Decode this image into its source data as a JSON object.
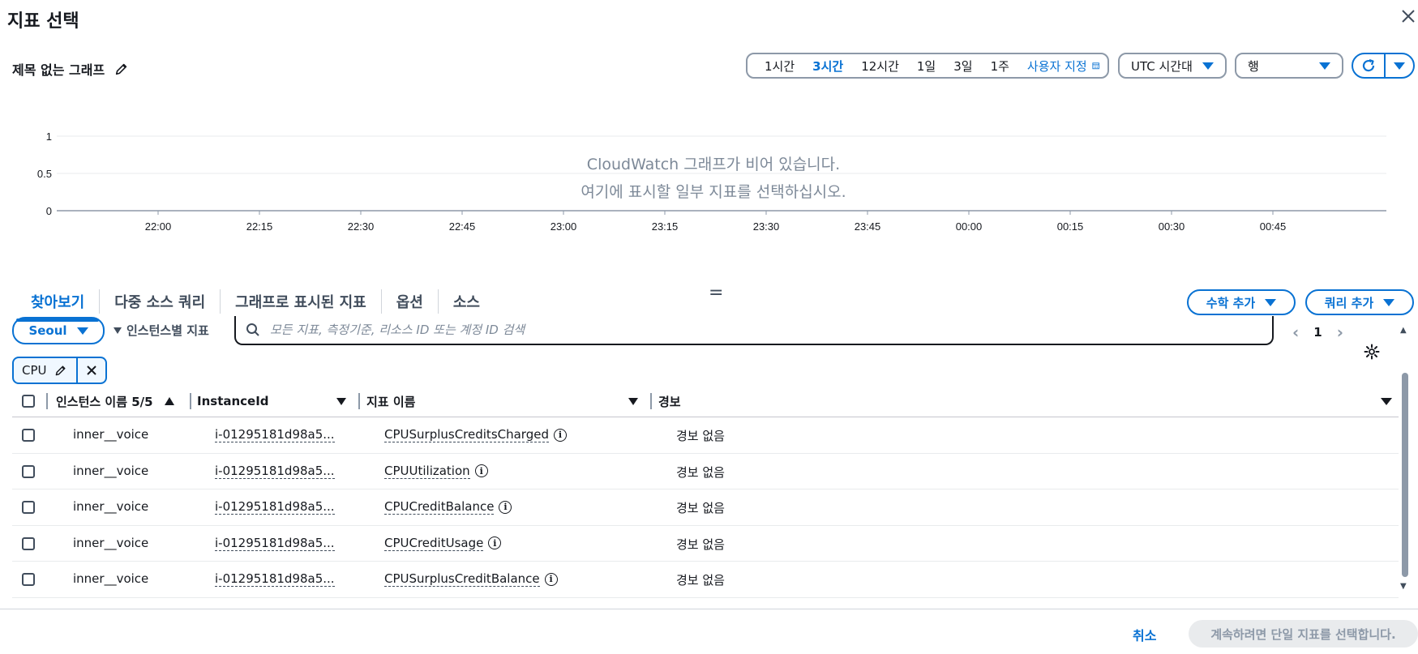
{
  "modal": {
    "title": "지표 선택"
  },
  "graph": {
    "title": "제목 없는 그래프"
  },
  "timerange": {
    "options": [
      "1시간",
      "3시간",
      "12시간",
      "1일",
      "3일",
      "1주"
    ],
    "active": "3시간",
    "custom_label": "사용자 지정"
  },
  "timezone": {
    "value": "UTC 시간대"
  },
  "layout_select": {
    "value": "행"
  },
  "chart_data": {
    "type": "line",
    "y_ticks": [
      "1",
      "0.5",
      "0"
    ],
    "x_ticks": [
      "22:00",
      "22:15",
      "22:30",
      "22:45",
      "23:00",
      "23:15",
      "23:30",
      "23:45",
      "00:00",
      "00:15",
      "00:30",
      "00:45"
    ],
    "ylim": [
      0,
      1
    ],
    "series": [],
    "empty_line1": "CloudWatch 그래프가 비어 있습니다.",
    "empty_line2": "여기에 표시할 일부 지표를 선택하십시오."
  },
  "tabs": [
    "찾아보기",
    "다중 소스 쿼리",
    "그래프로 표시된 지표",
    "옵션",
    "소스"
  ],
  "active_tab": "찾아보기",
  "buttons": {
    "math": "수학 추가",
    "query": "쿼리 추가"
  },
  "browse": {
    "region": "Seoul",
    "breadcrumb": "인스턴스별 지표",
    "search_placeholder": "모든 지표, 측정기준, 리소스 ID 또는 계정 ID 검색",
    "page": "1",
    "token": "CPU"
  },
  "table": {
    "headers": [
      "인스턴스 이름 5/5",
      "InstanceId",
      "지표 이름",
      "경보"
    ],
    "rows": [
      {
        "name": "inner__voice",
        "id": "i-01295181d98a5...",
        "metric": "CPUSurplusCreditsCharged",
        "alarm": "경보 없음"
      },
      {
        "name": "inner__voice",
        "id": "i-01295181d98a5...",
        "metric": "CPUUtilization",
        "alarm": "경보 없음"
      },
      {
        "name": "inner__voice",
        "id": "i-01295181d98a5...",
        "metric": "CPUCreditBalance",
        "alarm": "경보 없음"
      },
      {
        "name": "inner__voice",
        "id": "i-01295181d98a5...",
        "metric": "CPUCreditUsage",
        "alarm": "경보 없음"
      },
      {
        "name": "inner__voice",
        "id": "i-01295181d98a5...",
        "metric": "CPUSurplusCreditBalance",
        "alarm": "경보 없음"
      }
    ]
  },
  "footer": {
    "cancel": "취소",
    "continue": "계속하려면 단일 지표를 선택합니다."
  },
  "colors": {
    "accent": "#0972d3",
    "muted": "#7d8998",
    "text": "#16191f"
  }
}
